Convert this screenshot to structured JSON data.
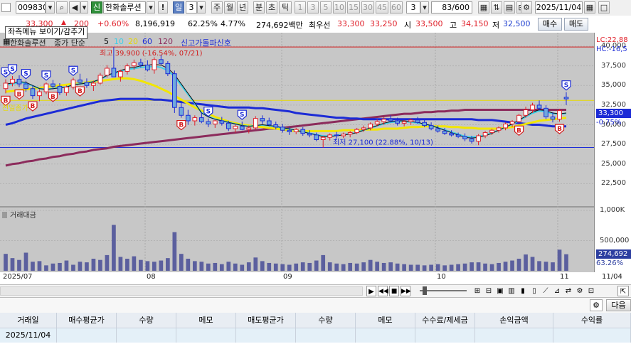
{
  "toolbar": {
    "code": "009830",
    "stock_name": "한화솔루션",
    "badge": "신",
    "warn": "!",
    "period_buttons": [
      "일",
      "3",
      "주",
      "월",
      "년",
      "분",
      "초",
      "틱"
    ],
    "n_buttons": [
      "1",
      "3",
      "5",
      "10",
      "15",
      "30",
      "45",
      "60"
    ],
    "count_dropdown": "3",
    "page_counter": "83/600",
    "date": "2025/11/04"
  },
  "quote": {
    "tooltip": "좌측메뉴 보이기/감추기",
    "price": "33,300",
    "change": "200",
    "change_pct": "+0.60%",
    "volume": "8,196,919",
    "vol_ratio": "62.25%",
    "turnover": "4.77%",
    "amount": "274,692백만",
    "best_ask_label": "최우선",
    "best_ask": "33,300",
    "best_bid": "33,250",
    "open_label": "시",
    "open": "33,500",
    "high_label": "고",
    "high": "34,150",
    "low_label": "저",
    "low": "32,500",
    "buy_label": "매수",
    "sell_label": "매도"
  },
  "legend": {
    "name": "한화솔루션",
    "ma_label": "종가 단순",
    "ma_periods": [
      "5",
      "10",
      "20",
      "60",
      "120"
    ],
    "signal_label": "신고가돌파신호",
    "lc": "LC:22,88",
    "hc": "HC:-16,5"
  },
  "chart": {
    "price_ticks": [
      "40,000",
      "37,500",
      "35,000",
      "32,500",
      "30,000",
      "27,500",
      "25,000",
      "22,500"
    ],
    "volume_ticks": [
      "1,000K",
      "500,000"
    ],
    "volume_title": "거래대금",
    "current_price": "33,300",
    "current_pct": "-0.75%",
    "volume_tag": "274,692",
    "volume_pct": "63.26%",
    "high_note": "최고 39,900 (-16.54%, 07/21)",
    "low_note": "최저 27,100 (22.88%, 10/13)",
    "prev_close_label": "전일종가",
    "x_labels": [
      "2025/07",
      "08",
      "09",
      "10",
      "11",
      "11/04"
    ]
  },
  "chart_data": {
    "type": "candlestick",
    "price_range": [
      20000,
      41000
    ],
    "overall_high": 39900,
    "overall_low": 27100,
    "prev_close": 33100,
    "candles": [
      [
        34600,
        35800,
        34000,
        35300
      ],
      [
        35300,
        36200,
        34900,
        35800
      ],
      [
        35800,
        36300,
        34800,
        35200
      ],
      [
        35200,
        35600,
        34200,
        34600
      ],
      [
        34600,
        35000,
        33300,
        33700
      ],
      [
        33700,
        34500,
        33000,
        34200
      ],
      [
        34200,
        35400,
        33900,
        35200
      ],
      [
        35200,
        35700,
        34500,
        34900
      ],
      [
        34900,
        35300,
        33800,
        34100
      ],
      [
        34100,
        35000,
        33700,
        34800
      ],
      [
        34800,
        36000,
        34500,
        35700
      ],
      [
        35700,
        36500,
        35200,
        35400
      ],
      [
        35400,
        35900,
        34700,
        35000
      ],
      [
        35000,
        35600,
        34300,
        35300
      ],
      [
        35300,
        36600,
        35100,
        36300
      ],
      [
        36300,
        37600,
        36000,
        37200
      ],
      [
        37200,
        39900,
        36800,
        36100
      ],
      [
        36100,
        37000,
        35500,
        36800
      ],
      [
        36800,
        37800,
        36400,
        37500
      ],
      [
        37500,
        38300,
        37000,
        37900
      ],
      [
        37900,
        38400,
        37300,
        37600
      ],
      [
        37600,
        38200,
        36800,
        37000
      ],
      [
        37000,
        38600,
        36500,
        38300
      ],
      [
        38300,
        38900,
        37600,
        37800
      ],
      [
        37800,
        38100,
        36200,
        36500
      ],
      [
        36500,
        36900,
        31500,
        32200
      ],
      [
        32200,
        32800,
        30900,
        31200
      ],
      [
        31200,
        31900,
        30000,
        30500
      ],
      [
        30500,
        31200,
        29900,
        30900
      ],
      [
        30900,
        31600,
        30200,
        30400
      ],
      [
        30400,
        30800,
        29700,
        30100
      ],
      [
        30100,
        30700,
        29600,
        30500
      ],
      [
        30500,
        31000,
        29900,
        30200
      ],
      [
        30200,
        30500,
        29200,
        29500
      ],
      [
        29500,
        30100,
        29000,
        29800
      ],
      [
        29800,
        30400,
        29300,
        29400
      ],
      [
        29400,
        29900,
        28900,
        29600
      ],
      [
        29600,
        31100,
        29400,
        30800
      ],
      [
        30800,
        31200,
        30100,
        30500
      ],
      [
        30500,
        30900,
        29800,
        30000
      ],
      [
        30000,
        30400,
        29400,
        29700
      ],
      [
        29700,
        30100,
        29000,
        29300
      ],
      [
        29300,
        29700,
        28700,
        29100
      ],
      [
        29100,
        29600,
        28800,
        29400
      ],
      [
        29400,
        29700,
        28600,
        28900
      ],
      [
        28900,
        29300,
        28400,
        28700
      ],
      [
        28700,
        29000,
        27900,
        28100
      ],
      [
        28100,
        28600,
        27100,
        28400
      ],
      [
        28400,
        28900,
        28000,
        28700
      ],
      [
        28700,
        29100,
        28200,
        28600
      ],
      [
        28600,
        29000,
        28300,
        28800
      ],
      [
        28800,
        29200,
        28400,
        29000
      ],
      [
        29000,
        29600,
        28800,
        29400
      ],
      [
        29400,
        29900,
        29100,
        29600
      ],
      [
        29600,
        30300,
        29300,
        30100
      ],
      [
        30100,
        30700,
        29800,
        30400
      ],
      [
        30400,
        31000,
        30000,
        30700
      ],
      [
        30700,
        31200,
        30300,
        30500
      ],
      [
        30500,
        30900,
        29900,
        30200
      ],
      [
        30200,
        30600,
        29800,
        30400
      ],
      [
        30400,
        30800,
        30000,
        30600
      ],
      [
        30600,
        31000,
        30100,
        30300
      ],
      [
        30300,
        30700,
        29700,
        29900
      ],
      [
        29900,
        30300,
        29300,
        29500
      ],
      [
        29500,
        29900,
        29000,
        29200
      ],
      [
        29200,
        29600,
        28700,
        28900
      ],
      [
        28900,
        29300,
        28500,
        28700
      ],
      [
        28700,
        29000,
        28300,
        28500
      ],
      [
        28500,
        28900,
        27900,
        28200
      ],
      [
        28200,
        28600,
        27600,
        27900
      ],
      [
        27900,
        28800,
        27400,
        28600
      ],
      [
        28600,
        29200,
        28300,
        29000
      ],
      [
        29000,
        29500,
        28700,
        29300
      ],
      [
        29300,
        29800,
        29000,
        29600
      ],
      [
        29600,
        30300,
        29300,
        30100
      ],
      [
        30100,
        30600,
        29700,
        30400
      ],
      [
        30400,
        31400,
        30200,
        31200
      ],
      [
        31200,
        32300,
        30900,
        31900
      ],
      [
        31900,
        32800,
        31500,
        32500
      ],
      [
        32500,
        33100,
        31800,
        32100
      ],
      [
        32100,
        32500,
        30700,
        31000
      ],
      [
        31000,
        31600,
        30300,
        30700
      ],
      [
        30700,
        32000,
        30400,
        31800
      ],
      [
        33500,
        34150,
        32500,
        33300
      ]
    ],
    "ma5": [
      35200,
      35300,
      35500,
      35400,
      35000,
      34600,
      34500,
      34600,
      34700,
      34800,
      35100,
      35200,
      35300,
      35500,
      35800,
      36300,
      36600,
      36900,
      37200,
      37300,
      37500,
      37600,
      37700,
      37600,
      37200,
      36400,
      35200,
      34000,
      32800,
      31500,
      31000,
      30700,
      30500,
      30300,
      30100,
      29900,
      29800,
      29900,
      30000,
      29900,
      29800,
      29600,
      29500,
      29300,
      29100,
      28900,
      28700,
      28500,
      28500,
      28600,
      28700,
      28800,
      29000,
      29300,
      29600,
      29900,
      30200,
      30400,
      30500,
      30500,
      30400,
      30300,
      30100,
      29900,
      29600,
      29300,
      29000,
      28700,
      28400,
      28300,
      28400,
      28600,
      28900,
      29300,
      29700,
      30100,
      30600,
      31100,
      31600,
      31900,
      31800,
      31500,
      31400,
      31500
    ],
    "ma20": [
      34200,
      34300,
      34400,
      34500,
      34600,
      34700,
      34800,
      34900,
      35000,
      35100,
      35200,
      35300,
      35400,
      35500,
      35600,
      35700,
      35800,
      35900,
      35900,
      35800,
      35600,
      35300,
      35000,
      34600,
      34200,
      33700,
      33200,
      32700,
      32200,
      31800,
      31400,
      31000,
      30700,
      30400,
      30200,
      30000,
      29900,
      29800,
      29700,
      29600,
      29500,
      29400,
      29300,
      29200,
      29200,
      29200,
      29200,
      29200,
      29200,
      29200,
      29300,
      29300,
      29300,
      29400,
      29400,
      29400,
      29500,
      29500,
      29500,
      29600,
      29700,
      29700,
      29800,
      29800,
      29800,
      29800,
      29700,
      29700,
      29600,
      29600,
      29500,
      29500,
      29500,
      29500,
      29600,
      29700,
      29900,
      30100,
      30300,
      30500,
      30600,
      30700,
      30800,
      30900
    ],
    "ma60": [
      30000,
      30200,
      30500,
      30800,
      31000,
      31200,
      31400,
      31600,
      31800,
      32000,
      32200,
      32400,
      32600,
      32800,
      33000,
      33100,
      33200,
      33300,
      33300,
      33300,
      33300,
      33300,
      33200,
      33200,
      33100,
      33000,
      32900,
      32800,
      32700,
      32600,
      32500,
      32400,
      32300,
      32200,
      32200,
      32200,
      32200,
      32100,
      32100,
      32000,
      31900,
      31800,
      31700,
      31500,
      31400,
      31300,
      31200,
      31100,
      31000,
      30900,
      30900,
      30800,
      30800,
      30700,
      30700,
      30700,
      30700,
      30700,
      30700,
      30700,
      30700,
      30700,
      30700,
      30700,
      30700,
      30700,
      30700,
      30700,
      30700,
      30700,
      30600,
      30600,
      30600,
      30500,
      30400,
      30300,
      30200,
      30100,
      30000,
      30000,
      29900,
      29800,
      29800,
      29800
    ],
    "ma120": [
      24800,
      25000,
      25100,
      25300,
      25400,
      25600,
      25700,
      25900,
      26000,
      26200,
      26300,
      26500,
      26600,
      26800,
      26900,
      27000,
      27200,
      27300,
      27400,
      27500,
      27600,
      27700,
      27800,
      27900,
      28000,
      28100,
      28200,
      28300,
      28400,
      28500,
      28600,
      28700,
      28800,
      28900,
      29000,
      29100,
      29200,
      29300,
      29400,
      29500,
      29500,
      29600,
      29700,
      29800,
      29900,
      30000,
      30100,
      30200,
      30300,
      30400,
      30500,
      30600,
      30700,
      30800,
      30900,
      31000,
      31100,
      31200,
      31300,
      31400,
      31400,
      31500,
      31600,
      31600,
      31700,
      31700,
      31800,
      31800,
      31900,
      31900,
      31900,
      31900,
      31900,
      31900,
      31900,
      31900,
      31900,
      31900,
      31900,
      31900,
      31900,
      31900,
      31900,
      31900
    ],
    "volume_amount_million": [
      280,
      210,
      180,
      300,
      150,
      160,
      90,
      120,
      130,
      170,
      100,
      150,
      140,
      200,
      180,
      260,
      760,
      230,
      200,
      240,
      180,
      160,
      150,
      170,
      210,
      640,
      280,
      200,
      160,
      150,
      120,
      130,
      110,
      150,
      120,
      100,
      140,
      220,
      160,
      130,
      120,
      110,
      100,
      120,
      140,
      130,
      170,
      260,
      140,
      120,
      110,
      130,
      120,
      140,
      180,
      150,
      130,
      140,
      120,
      110,
      100,
      100,
      90,
      100,
      110,
      90,
      100,
      110,
      120,
      140,
      140,
      120,
      110,
      130,
      150,
      170,
      200,
      270,
      230,
      160,
      150,
      140,
      350,
      274
    ]
  },
  "buttons": {
    "next": "다음"
  },
  "table": {
    "headers": [
      "거래일",
      "매수평균가",
      "수량",
      "메모",
      "매도평균가",
      "수량",
      "메모",
      "수수료/제세금",
      "손익금액",
      "수익률"
    ],
    "row": {
      "date": "2025/11/04"
    }
  }
}
